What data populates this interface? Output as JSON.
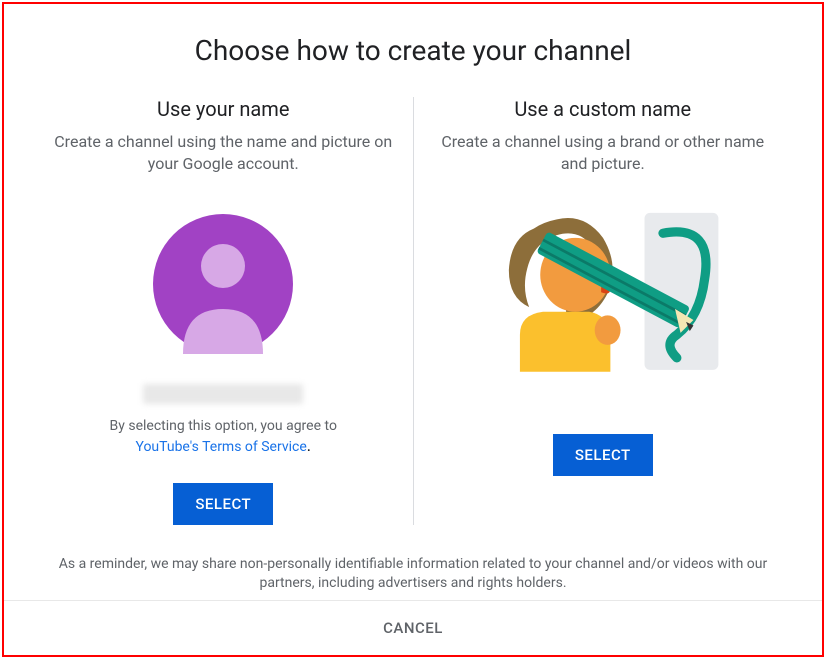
{
  "title": "Choose how to create your channel",
  "option_left": {
    "title": "Use your name",
    "description": "Create a channel using the name and picture on your Google account.",
    "agree_text": "By selecting this option, you agree to",
    "tos_link_text": "YouTube's Terms of Service",
    "tos_period": ".",
    "select_label": "SELECT"
  },
  "option_right": {
    "title": "Use a custom name",
    "description": "Create a channel using a brand or other name and picture.",
    "select_label": "SELECT"
  },
  "footer_note": "As a reminder, we may share non-personally identifiable information related to your channel and/or videos with our partners, including advertisers and rights holders.",
  "cancel_label": "CANCEL",
  "colors": {
    "primary_button": "#065fd4",
    "link": "#1a73e8",
    "text_secondary": "#5f6368",
    "avatar": "#a142c4"
  }
}
